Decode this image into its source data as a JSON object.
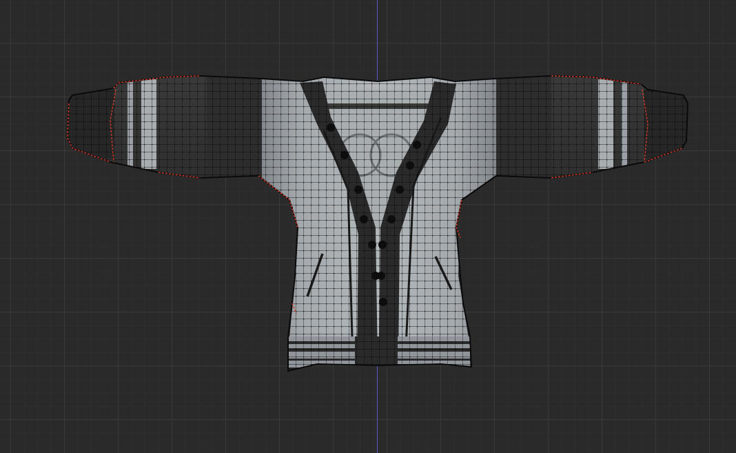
{
  "viewport": {
    "mode": "edit-mode-uv-mesh-view",
    "background_color": "#2a2a2a",
    "grid_color": "#3a3a3a",
    "axis_color": "#5a5ac8"
  },
  "model": {
    "subject": "cardigan-sweater",
    "colors": {
      "light_fabric": "#9aa0a5",
      "dark_fabric": "#2c2c2c",
      "wire": "#0a0a0a",
      "seam": "#d23a2a",
      "shirt": "#a8adb0"
    }
  }
}
